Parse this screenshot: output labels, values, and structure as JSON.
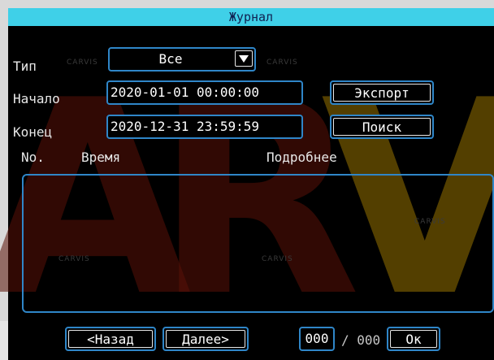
{
  "window": {
    "title": "Журнал"
  },
  "filters": {
    "type_label": "Тип",
    "type_value": "Все",
    "start_label": "Начало",
    "start_value": "2020-01-01 00:00:00",
    "end_label": "Конец",
    "end_value": "2020-12-31 23:59:59"
  },
  "actions": {
    "export_label": "Экспорт",
    "search_label": "Поиск"
  },
  "table": {
    "columns": [
      "No.",
      "Время",
      "Подробнее"
    ],
    "rows": []
  },
  "pagination": {
    "prev_label": "<Назад",
    "next_label": "Далее>",
    "current_page": "000",
    "separator": "/",
    "total_pages": "000",
    "ok_label": "Ок"
  },
  "watermark": {
    "brand_text": "CARVIS",
    "large_letters": "ARV"
  },
  "colors": {
    "titlebar": "#3fd0e8",
    "border_accent": "#2f86c8",
    "background": "#000000"
  }
}
